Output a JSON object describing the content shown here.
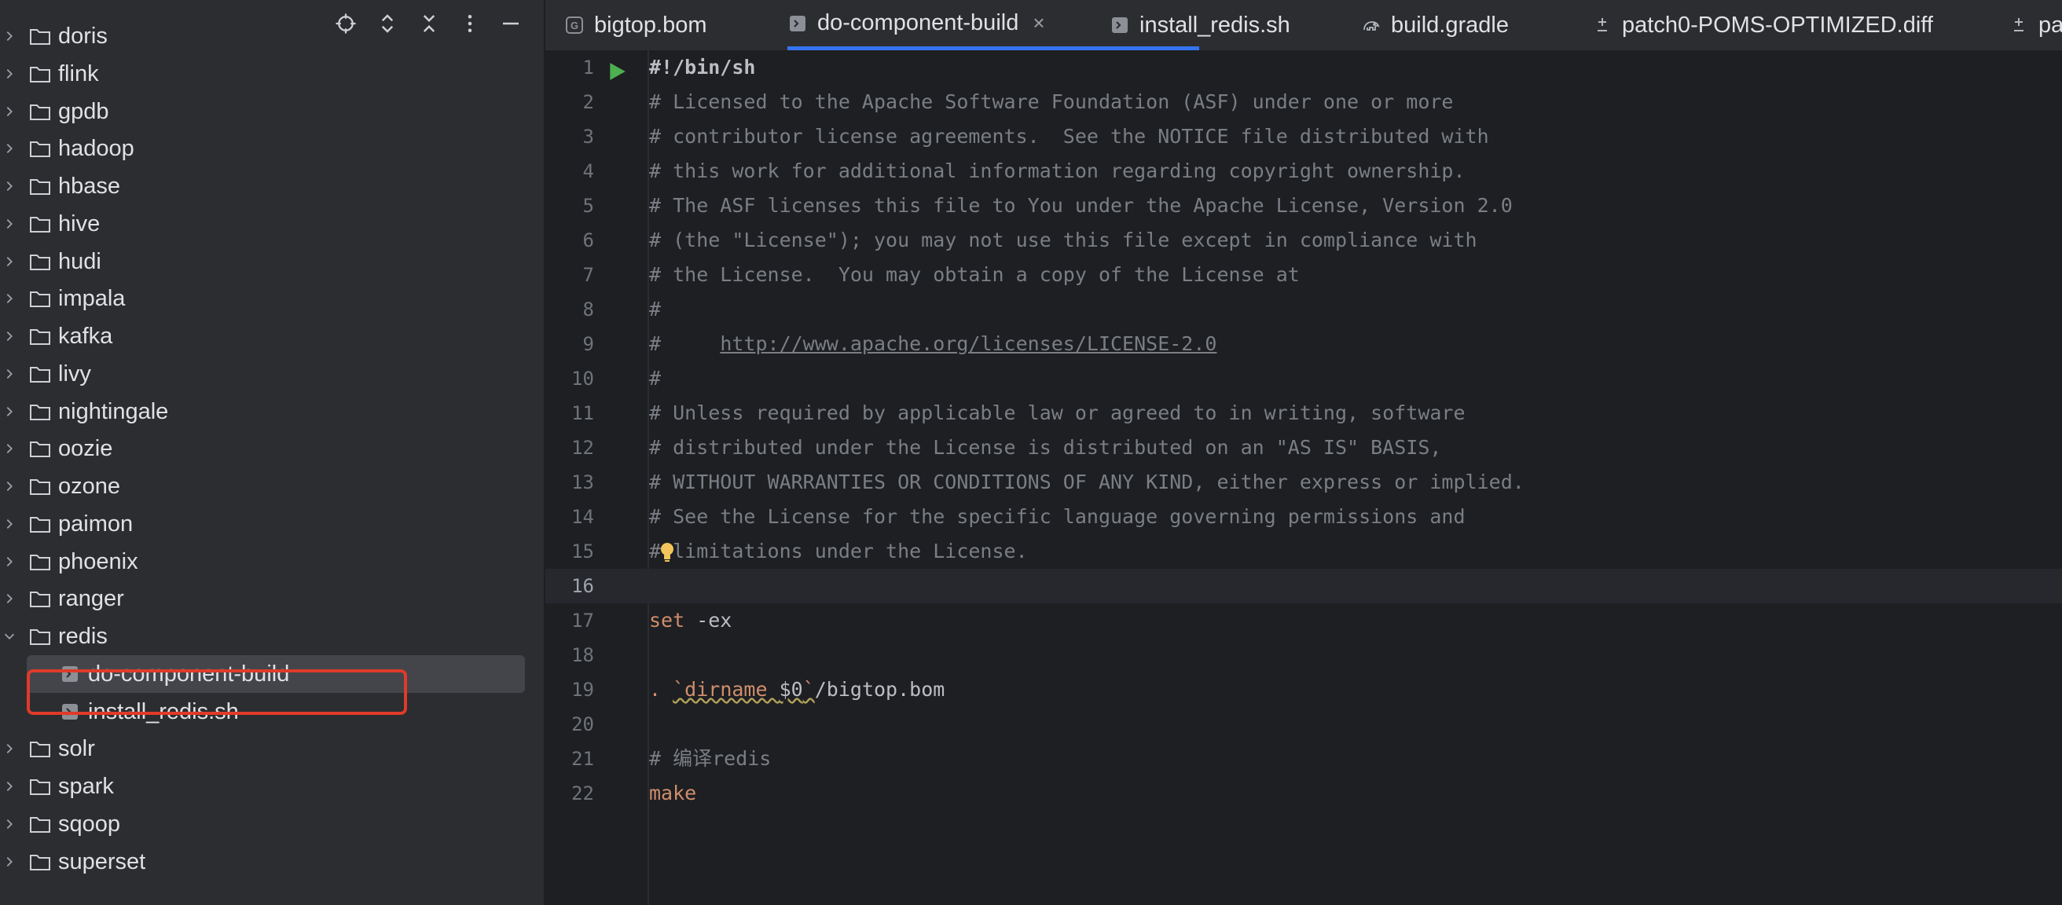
{
  "sidebar": {
    "toolbar": {
      "locate_icon": "crosshair-icon",
      "expand_icon": "expand-collapse-icon",
      "collapse_icon": "close-collapse-icon",
      "options_icon": "more-vertical-icon",
      "hide_icon": "minimize-icon"
    },
    "tree": [
      {
        "label": "doris",
        "type": "folder",
        "expanded": false
      },
      {
        "label": "flink",
        "type": "folder",
        "expanded": false
      },
      {
        "label": "gpdb",
        "type": "folder",
        "expanded": false
      },
      {
        "label": "hadoop",
        "type": "folder",
        "expanded": false
      },
      {
        "label": "hbase",
        "type": "folder",
        "expanded": false
      },
      {
        "label": "hive",
        "type": "folder",
        "expanded": false
      },
      {
        "label": "hudi",
        "type": "folder",
        "expanded": false
      },
      {
        "label": "impala",
        "type": "folder",
        "expanded": false
      },
      {
        "label": "kafka",
        "type": "folder",
        "expanded": false
      },
      {
        "label": "livy",
        "type": "folder",
        "expanded": false
      },
      {
        "label": "nightingale",
        "type": "folder",
        "expanded": false
      },
      {
        "label": "oozie",
        "type": "folder",
        "expanded": false
      },
      {
        "label": "ozone",
        "type": "folder",
        "expanded": false
      },
      {
        "label": "paimon",
        "type": "folder",
        "expanded": false
      },
      {
        "label": "phoenix",
        "type": "folder",
        "expanded": false
      },
      {
        "label": "ranger",
        "type": "folder",
        "expanded": false
      },
      {
        "label": "redis",
        "type": "folder",
        "expanded": true
      },
      {
        "label": "do-component-build",
        "type": "file",
        "selected": true
      },
      {
        "label": "install_redis.sh",
        "type": "file",
        "selected": false
      },
      {
        "label": "solr",
        "type": "folder",
        "expanded": false
      },
      {
        "label": "spark",
        "type": "folder",
        "expanded": false
      },
      {
        "label": "sqoop",
        "type": "folder",
        "expanded": false
      },
      {
        "label": "superset",
        "type": "folder",
        "expanded": false
      }
    ]
  },
  "tabs": [
    {
      "label": "bigtop.bom",
      "icon": "gradle-file-icon",
      "active": false
    },
    {
      "label": "do-component-build",
      "icon": "shell-script-icon",
      "active": true,
      "close": "×"
    },
    {
      "label": "install_redis.sh",
      "icon": "shell-script-icon",
      "active": false
    },
    {
      "label": "build.gradle",
      "icon": "gradle-elephant-icon",
      "active": false
    },
    {
      "label": "patch0-POMS-OPTIMIZED.diff",
      "icon": "diff-icon",
      "active": false
    },
    {
      "label": "pa",
      "icon": "diff-icon",
      "active": false
    }
  ],
  "editor": {
    "current_line": 16,
    "lines": [
      {
        "n": "1",
        "text": "#!/bin/sh"
      },
      {
        "n": "2",
        "text": "# Licensed to the Apache Software Foundation (ASF) under one or more"
      },
      {
        "n": "3",
        "text": "# contributor license agreements.  See the NOTICE file distributed with"
      },
      {
        "n": "4",
        "text": "# this work for additional information regarding copyright ownership."
      },
      {
        "n": "5",
        "text": "# The ASF licenses this file to You under the Apache License, Version 2.0"
      },
      {
        "n": "6",
        "text": "# (the \"License\"); you may not use this file except in compliance with"
      },
      {
        "n": "7",
        "text": "# the License.  You may obtain a copy of the License at"
      },
      {
        "n": "8",
        "text": "#"
      },
      {
        "n": "9",
        "prefix": "#     ",
        "link": "http://www.apache.org/licenses/LICENSE-2.0"
      },
      {
        "n": "10",
        "text": "#"
      },
      {
        "n": "11",
        "text": "# Unless required by applicable law or agreed to in writing, software"
      },
      {
        "n": "12",
        "text": "# distributed under the License is distributed on an \"AS IS\" BASIS,"
      },
      {
        "n": "13",
        "text": "# WITHOUT WARRANTIES OR CONDITIONS OF ANY KIND, either express or implied."
      },
      {
        "n": "14",
        "text": "# See the License for the specific language governing permissions and"
      },
      {
        "n": "15",
        "text": "# limitations under the License."
      },
      {
        "n": "16",
        "text": ""
      },
      {
        "n": "17",
        "kw": "set",
        "rest": " -ex"
      },
      {
        "n": "18",
        "text": ""
      },
      {
        "n": "19",
        "dot": ". ",
        "sub_open": "`dirname ",
        "sub_var": "$0",
        "sub_close": "`",
        "rest": "/bigtop.bom"
      },
      {
        "n": "20",
        "text": ""
      },
      {
        "n": "21",
        "text": "# 编译redis"
      },
      {
        "n": "22",
        "kw": "make"
      }
    ]
  },
  "colors": {
    "accent": "#3574f0",
    "highlight_box": "#e03a2a",
    "keyword": "#cf8e6d",
    "comment": "#7a7e85",
    "run": "#4caf50",
    "bulb": "#f2c55c"
  }
}
